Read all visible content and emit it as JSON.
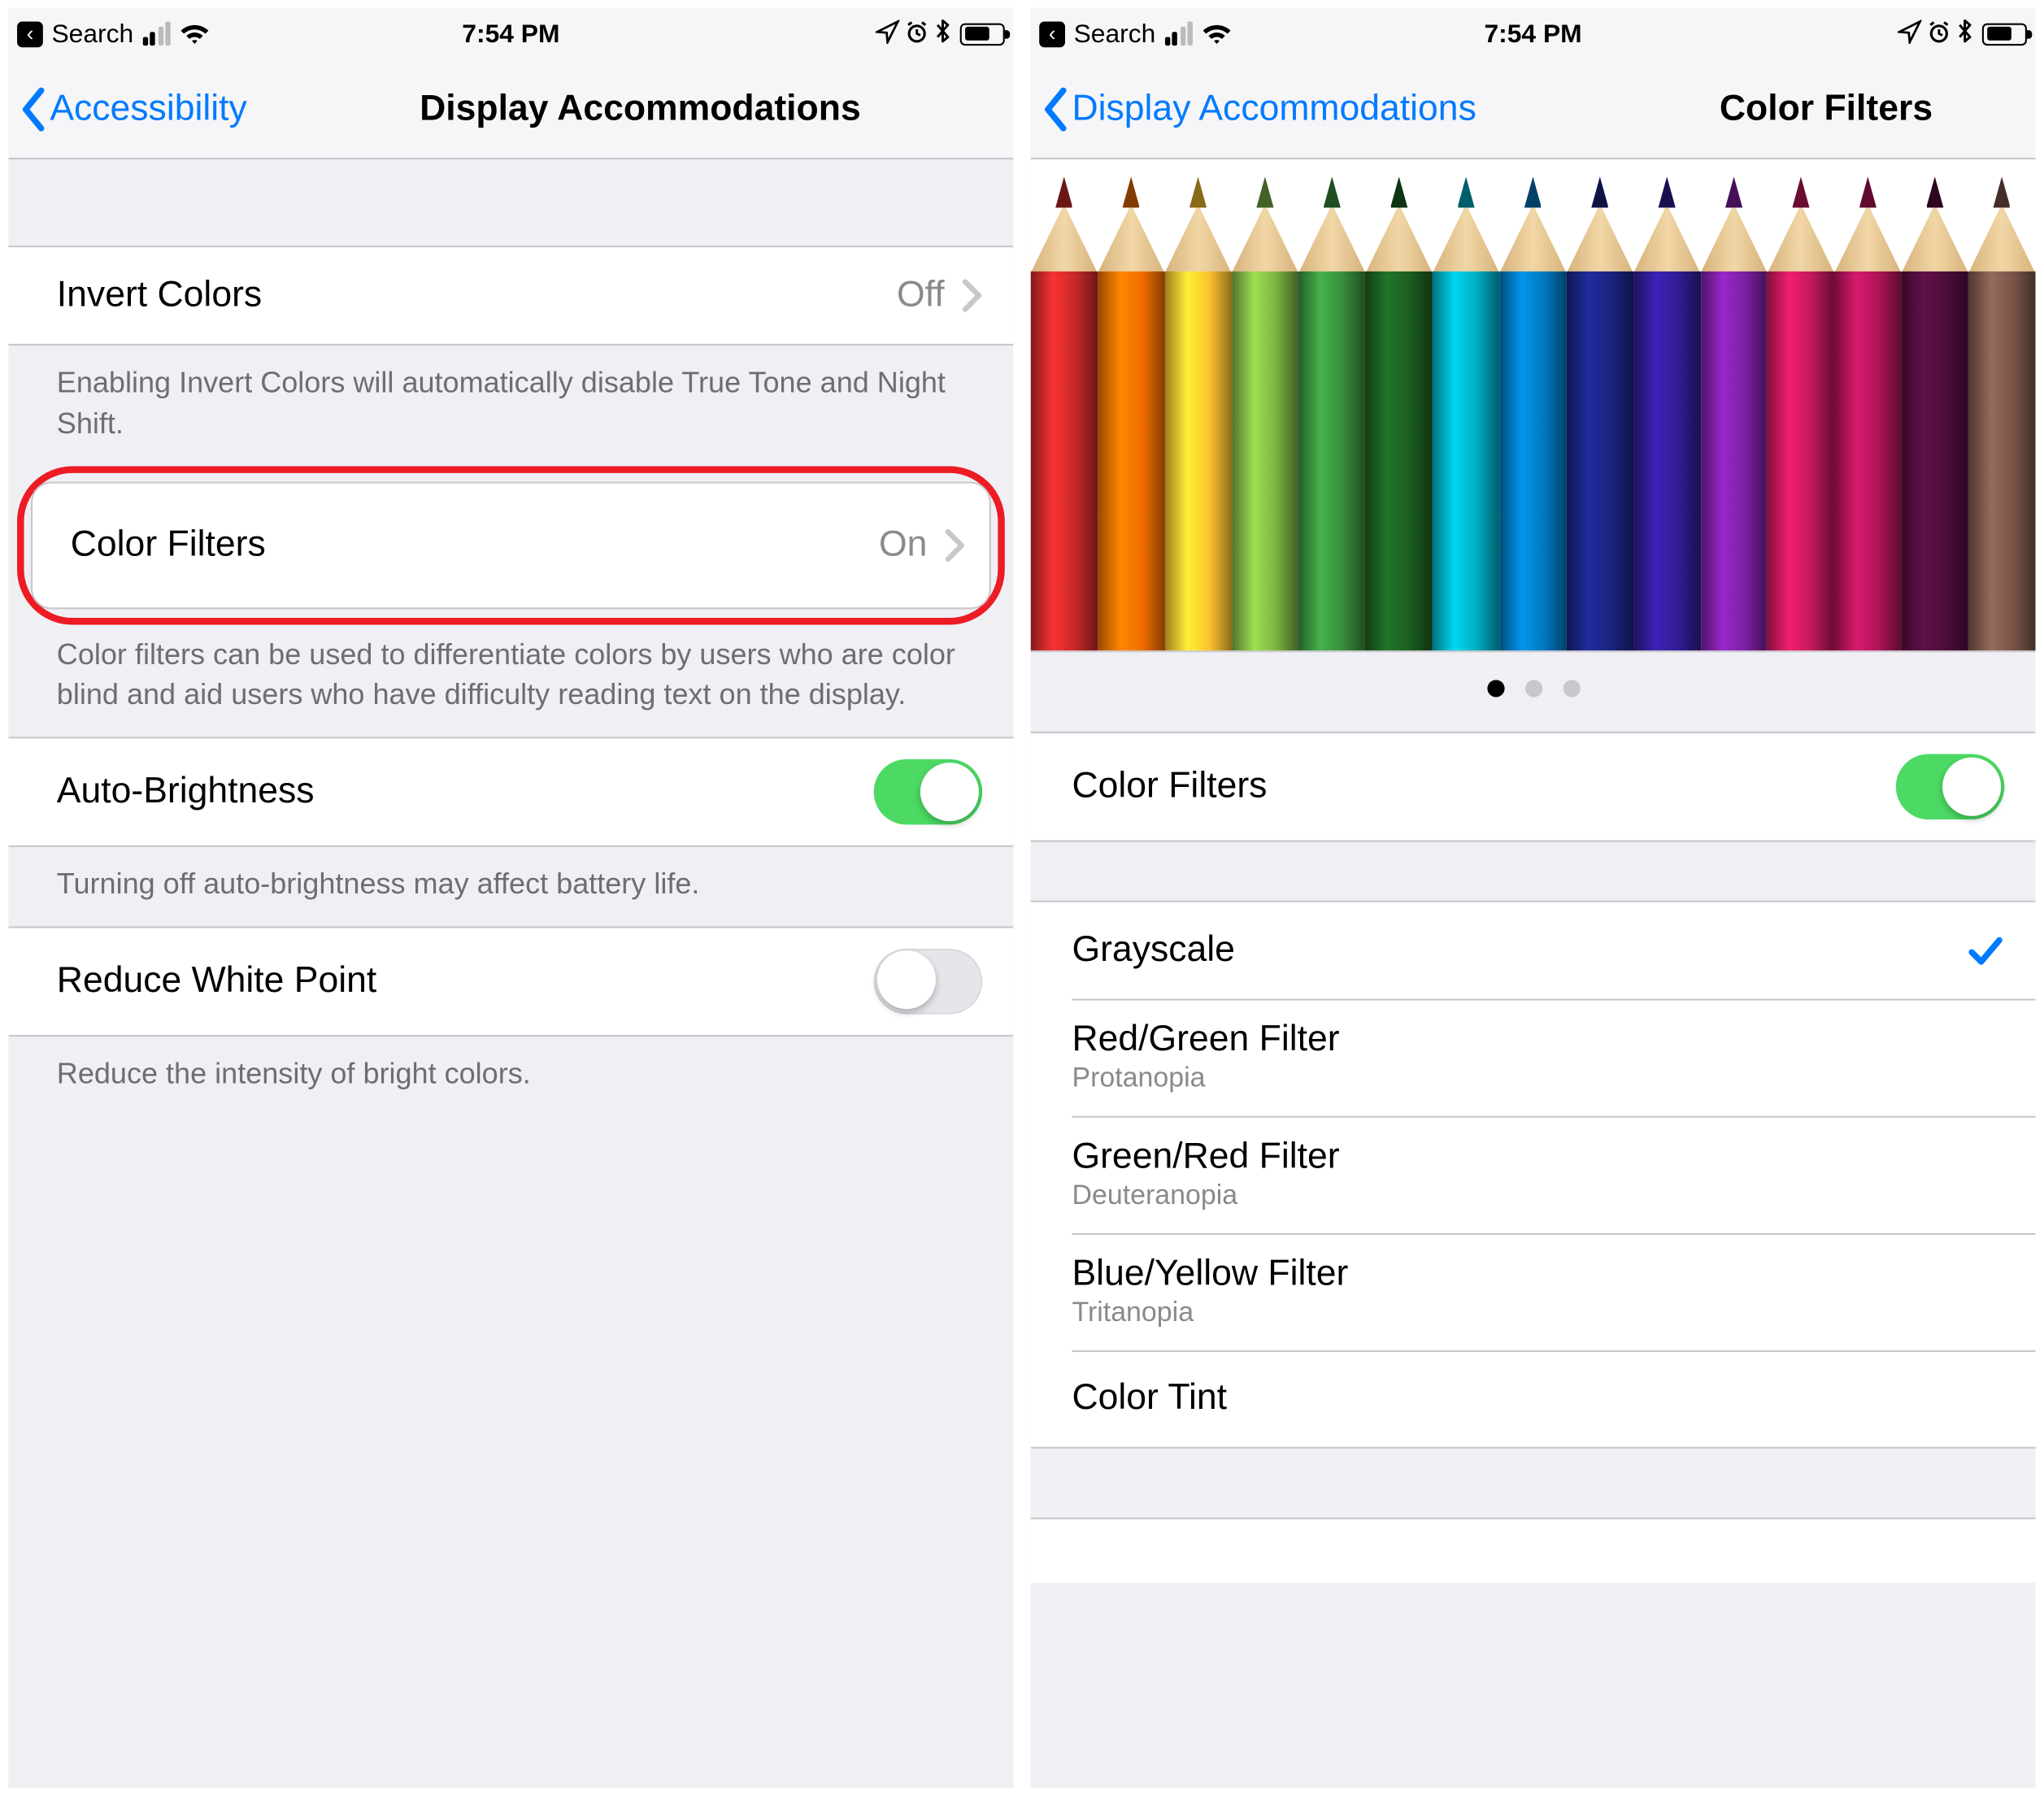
{
  "status": {
    "search": "Search",
    "time": "7:54 PM"
  },
  "left": {
    "back": "Accessibility",
    "title": "Display Accommodations",
    "invert": {
      "label": "Invert Colors",
      "value": "Off"
    },
    "invert_note": "Enabling Invert Colors will automatically disable True Tone and Night Shift.",
    "cf": {
      "label": "Color Filters",
      "value": "On"
    },
    "cf_note": "Color filters can be used to differentiate colors by users who are color blind and aid users who have difficulty reading text on the display.",
    "auto": {
      "label": "Auto-Brightness"
    },
    "auto_note": "Turning off auto-brightness may affect battery life.",
    "rwp": {
      "label": "Reduce White Point"
    },
    "rwp_note": "Reduce the intensity of bright colors."
  },
  "right": {
    "back": "Display Accommodations",
    "title": "Color Filters",
    "cf_toggle": "Color Filters",
    "options": [
      {
        "label": "Grayscale",
        "sub": "",
        "selected": true
      },
      {
        "label": "Red/Green Filter",
        "sub": "Protanopia",
        "selected": false
      },
      {
        "label": "Green/Red Filter",
        "sub": "Deuteranopia",
        "selected": false
      },
      {
        "label": "Blue/Yellow Filter",
        "sub": "Tritanopia",
        "selected": false
      },
      {
        "label": "Color Tint",
        "sub": "",
        "selected": false
      }
    ]
  },
  "pencil_colors": [
    "#c62828",
    "#ef6c00",
    "#fbc02d",
    "#7cb342",
    "#388e3c",
    "#1b5e20",
    "#00acc1",
    "#0277bd",
    "#1a237e",
    "#311b92",
    "#7b1fa2",
    "#c2185b",
    "#ad1457",
    "#4e0d3a",
    "#795548"
  ]
}
